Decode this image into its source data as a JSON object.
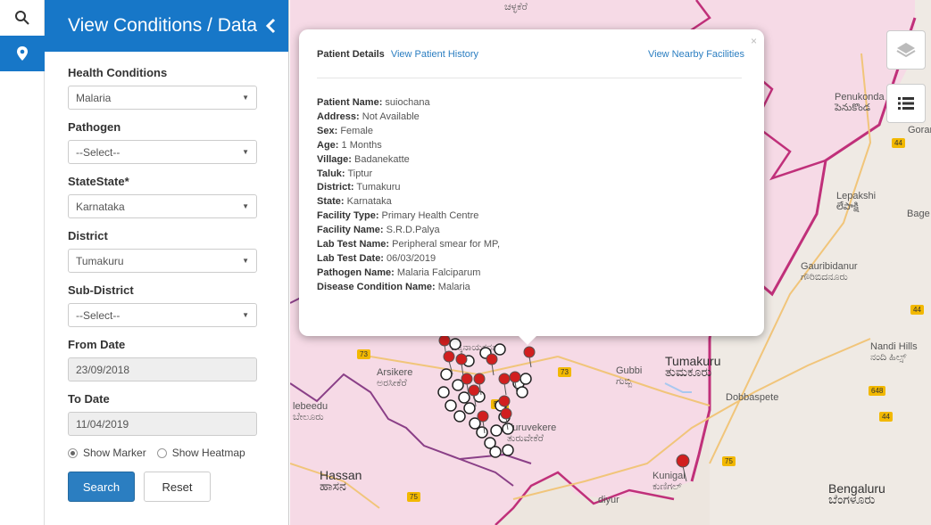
{
  "panel": {
    "title": "View Conditions / Data",
    "health_conditions": {
      "label": "Health Conditions",
      "value": "Malaria"
    },
    "pathogen": {
      "label": "Pathogen",
      "value": "--Select--"
    },
    "state": {
      "label": "StateState*",
      "value": "Karnataka"
    },
    "district": {
      "label": "District",
      "value": "Tumakuru"
    },
    "sub_district": {
      "label": "Sub-District",
      "value": "--Select--"
    },
    "from_date": {
      "label": "From Date",
      "value": "23/09/2018"
    },
    "to_date": {
      "label": "To Date",
      "value": "11/04/2019"
    },
    "radio_marker": "Show Marker",
    "radio_heatmap": "Show Heatmap",
    "search_label": "Search",
    "reset_label": "Reset"
  },
  "popup": {
    "tab_active": "Patient Details",
    "tab_history": "View Patient History",
    "tab_nearby": "View Nearby Facilities",
    "close": "×",
    "rows": [
      {
        "k": "Patient Name:",
        "v": "suiochana"
      },
      {
        "k": "Address:",
        "v": "Not Available"
      },
      {
        "k": "Sex:",
        "v": "Female"
      },
      {
        "k": "Age:",
        "v": "1 Months"
      },
      {
        "k": "Village:",
        "v": "Badanekatte"
      },
      {
        "k": "Taluk:",
        "v": "Tiptur"
      },
      {
        "k": "District:",
        "v": "Tumakuru"
      },
      {
        "k": "State:",
        "v": "Karnataka"
      },
      {
        "k": "Facility Type:",
        "v": "Primary Health Centre"
      },
      {
        "k": "Facility Name:",
        "v": "S.R.D.Palya"
      },
      {
        "k": "Lab Test Name:",
        "v": "Peripheral smear for MP,"
      },
      {
        "k": "Lab Test Date:",
        "v": "06/03/2019"
      },
      {
        "k": "Pathogen Name:",
        "v": "Malaria Falciparum"
      },
      {
        "k": "Disease Condition Name:",
        "v": "Malaria"
      }
    ]
  },
  "map": {
    "places": {
      "penukonda": "Penukonda",
      "penukonda_local": "పెనుకొండ",
      "goran": "Goran",
      "lepakshi": "Lepakshi",
      "lepakshi_local": "లేపాక్షి",
      "bage": "Bage",
      "gauribidanur": "Gauribidanur",
      "gauribidanur_local": "ಗೌರಿಬಿದನೂರು",
      "nandi_hills": "Nandi Hills",
      "nandi_local": "ನಂದಿ ಹಿಲ್ಸ್",
      "tumakuru": "Tumakuru",
      "tumakuru_local": "ತುಮಕೂರು",
      "gubbi": "Gubbi",
      "gubbi_local": "ಗುಬ್ಬಿ",
      "arsikere": "Arsikere",
      "arsikere_local": "ಅರಸೀಕೆರೆ",
      "tiptur_local": "ಚಿಕ್ಕನಾಯಕನಹಳ್ಳಿ",
      "dobbaspete": "Dobbaspete",
      "turuvekere": "Turuvekere",
      "turuvekere_local": "ತುರುವೇಕೆರೆ",
      "hassan": "Hassan",
      "hassan_local": "ಹಾಸನ",
      "belur": "lebeedu",
      "belur_local": "ಬೇಲೂರು",
      "kunigal": "Kunigal",
      "kunigal_local": "ಕುಣಿಗಲ್",
      "bengaluru": "Bengaluru",
      "bengaluru_local": "ಬೆಂಗಳೂರು",
      "chitradurga_local": "ಚಳ್ಳಕೆರೆ",
      "diyur": "diyur"
    },
    "road_numbers": [
      "44",
      "73",
      "73",
      "50A",
      "75",
      "75",
      "44",
      "44",
      "648"
    ]
  },
  "colors": {
    "accent": "#1777c8",
    "district_fill": "#f5d8e4",
    "state_border": "#c0307a",
    "marker_red": "#d11f1f"
  }
}
